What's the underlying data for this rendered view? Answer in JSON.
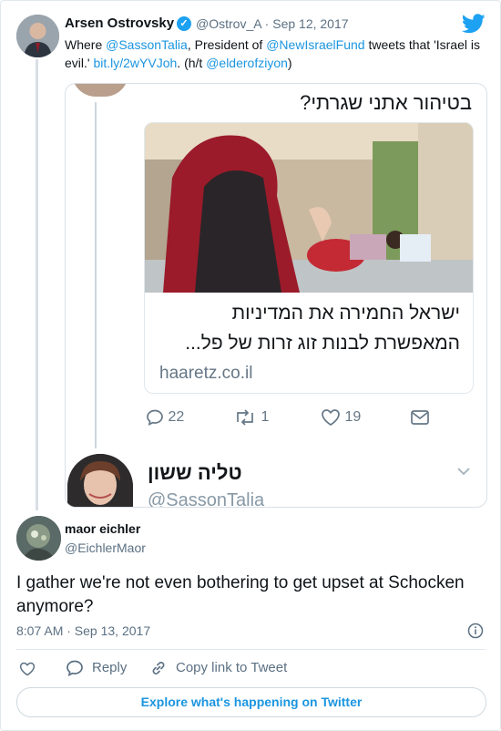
{
  "parent_tweet": {
    "author_name": "Arsen Ostrovsky",
    "handle_date": "@Ostrov_A · Sep 12, 2017",
    "text_where": "Where ",
    "mention_1": "@SassonTalia",
    "text_president": ", President of ",
    "mention_2": "@NewIsraelFund",
    "text_tweets": " tweets that 'Israel is evil.' ",
    "link": "bit.ly/2wYVJoh",
    "text_ht": ". (h/t ",
    "mention_3": "@elderofziyon",
    "text_close": ")"
  },
  "embedded": {
    "question": "בטיהור אתני שגרתי?",
    "headline_line1": "ישראל החמירה את המדיניות",
    "headline_line2": "המאפשרת לבנות זוג זרות של פל...",
    "domain": "haaretz.co.il",
    "reply_count": "22",
    "retweet_count": "1",
    "like_count": "19",
    "author_name": "טליה ששון",
    "author_handle": "@SassonTalia"
  },
  "reply_tweet": {
    "author_name": "maor eichler",
    "handle": "@EichlerMaor",
    "text": "I gather we're not even bothering to get upset at Schocken anymore?",
    "timestamp": "8:07 AM · Sep 13, 2017",
    "reply_label": "Reply",
    "copy_label": "Copy link to Tweet"
  },
  "footer": {
    "explore_label": "Explore what's happening on Twitter"
  },
  "colors": {
    "link": "#1b95e0",
    "verified": "#1da1f2",
    "secondary_text": "#5b7083"
  }
}
